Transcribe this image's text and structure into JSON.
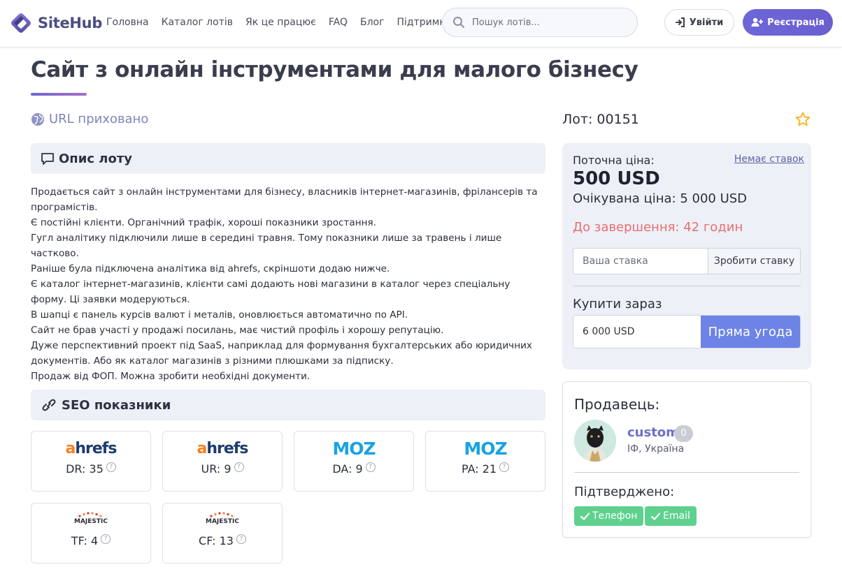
{
  "header": {
    "logo_text": "SiteHub",
    "nav": [
      "Головна",
      "Каталог лотів",
      "Як це працює",
      "FAQ",
      "Блог",
      "Підтримка"
    ],
    "search_placeholder": "Пошук лотів...",
    "login_label": "Увійти",
    "register_label": "Реєстрація"
  },
  "lot": {
    "title": "Сайт з онлайн інструментами для малого бізнесу",
    "url_status": "URL приховано",
    "number": "Лот: 00151"
  },
  "description": {
    "heading": "Опис лоту",
    "paragraphs": [
      "Продається сайт з онлайн інструментами для бізнесу, власників інтернет-магазинів, фрілансерів та програмістів.",
      "Є постійні клієнти. Органічний трафік, хороші показники зростання.",
      "Гугл аналітику підключили лише в середині травня. Тому показники лише за травень і лише частково.",
      "Раніше була підключена аналітика від ahrefs, скріншоти додаю нижче.",
      "Є каталог інтернет-магазинів, клієнти самі додають нові магазини в каталог через спеціальну форму. Ці заявки модеруються.",
      "В шапці є панель курсів валют і металів, оновлюється автоматично по API.",
      "Сайт не брав участі у продажі посилань, має чистий профіль і хорошу репутацію.",
      "Дуже перспективний проект під SaaS, наприклад для формування бухгалтерських або юридичних документів. Або як каталог магазинів з різними плюшками за підписку.",
      "Продаж від ФОП. Можна зробити необхідні документи."
    ]
  },
  "seo": {
    "heading": "SEO показники",
    "metrics": [
      {
        "brand": "ahrefs",
        "label": "DR: 35"
      },
      {
        "brand": "ahrefs",
        "label": "UR: 9"
      },
      {
        "brand": "moz",
        "label": "DA: 9"
      },
      {
        "brand": "moz",
        "label": "PA: 21"
      },
      {
        "brand": "majestic",
        "label": "TF: 4"
      },
      {
        "brand": "majestic",
        "label": "CF: 13"
      }
    ],
    "brand_texts": {
      "ahrefs_a": "a",
      "ahrefs_rest": "hrefs",
      "moz": "MOZ",
      "majestic": "MAJESTIC"
    }
  },
  "bid": {
    "current_label": "Поточна ціна:",
    "no_bids": "Немає ставок",
    "current_price": "500 USD",
    "expected": "Очікувана ціна: 5 000 USD",
    "time_left": "До завершення: 42 годин",
    "bid_placeholder": "Ваша ставка",
    "bid_button": "Зробити ставку",
    "buy_now_label": "Купити зараз",
    "buy_now_price": "6 000 USD",
    "buy_now_button": "Пряма угода"
  },
  "seller": {
    "title": "Продавець:",
    "name": "custom",
    "count": "0",
    "location": "ІФ, Україна",
    "verified_title": "Підтверджено:",
    "badges": [
      "Телефон",
      "Email"
    ]
  },
  "colors": {
    "accent": "#6d66d9",
    "buy_button": "#6d83e6",
    "time_left": "#e86f6f",
    "verified": "#5fd18f"
  }
}
